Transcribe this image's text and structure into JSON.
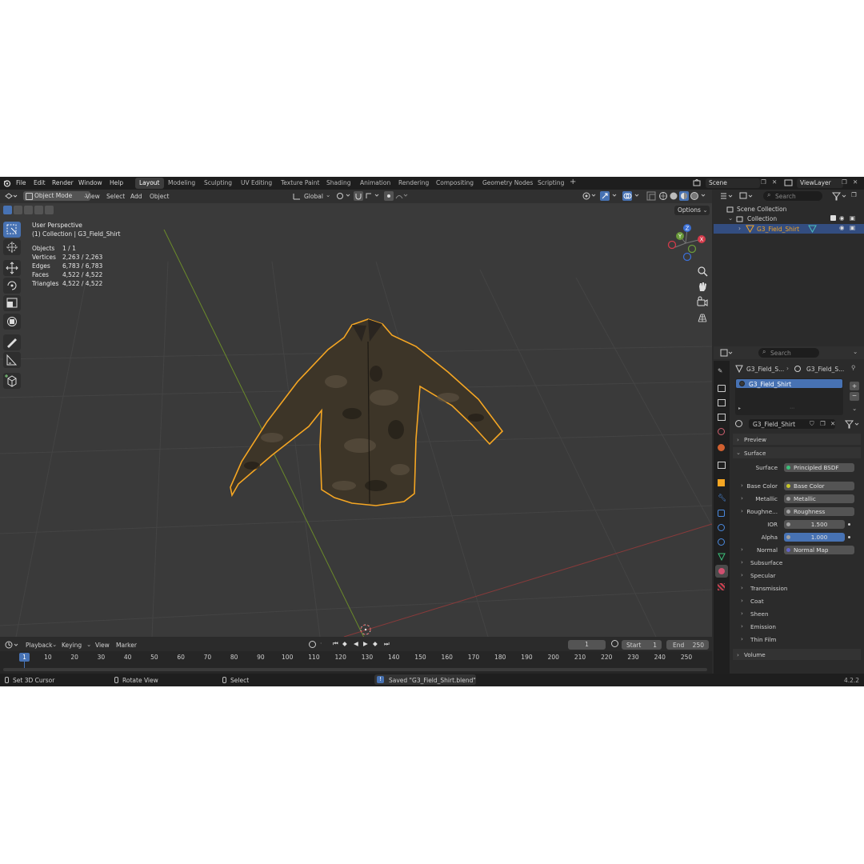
{
  "menu": [
    "File",
    "Edit",
    "Render",
    "Window",
    "Help"
  ],
  "workspaces": [
    "Layout",
    "Modeling",
    "Sculpting",
    "UV Editing",
    "Texture Paint",
    "Shading",
    "Animation",
    "Rendering",
    "Compositing",
    "Geometry Nodes",
    "Scripting"
  ],
  "active_workspace": "Layout",
  "scene": "Scene",
  "view_layer": "ViewLayer",
  "viewport": {
    "mode": "Object Mode",
    "menus": [
      "View",
      "Select",
      "Add",
      "Object"
    ],
    "orientation": "Global",
    "options": "Options",
    "perspective": "User Perspective",
    "collection_line": "(1) Collection | G3_Field_Shirt",
    "stats": [
      {
        "label": "Objects",
        "value": "1 / 1"
      },
      {
        "label": "Vertices",
        "value": "2,263 / 2,263"
      },
      {
        "label": "Edges",
        "value": "6,783 / 6,783"
      },
      {
        "label": "Faces",
        "value": "4,522 / 4,522"
      },
      {
        "label": "Triangles",
        "value": "4,522 / 4,522"
      }
    ],
    "gizmo": {
      "z": "Z",
      "y": "Y",
      "x": "X"
    }
  },
  "outliner": {
    "search_placeholder": "Search",
    "scene_collection": "Scene Collection",
    "collection": "Collection",
    "object": "G3_Field_Shirt"
  },
  "properties": {
    "search_placeholder": "Search",
    "breadcrumb_object": "G3_Field_S...",
    "breadcrumb_material": "G3_Field_S...",
    "slot": "G3_Field_Shirt",
    "material_name": "G3_Field_Shirt",
    "preview": "Preview",
    "surface_section": "Surface",
    "surface_label": "Surface",
    "surface_value": "Principled BSDF",
    "rows": [
      {
        "label": "Base Color",
        "value": "Base Color",
        "dot": "#c7c729"
      },
      {
        "label": "Metallic",
        "value": "Metallic",
        "dot": "#a1a1a1"
      },
      {
        "label": "Roughne...",
        "value": "Roughness",
        "dot": "#a1a1a1"
      }
    ],
    "ior_label": "IOR",
    "ior_value": "1.500",
    "alpha_label": "Alpha",
    "alpha_value": "1.000",
    "normal_label": "Normal",
    "normal_value": "Normal Map",
    "subsections": [
      "Subsurface",
      "Specular",
      "Transmission",
      "Coat",
      "Sheen",
      "Emission",
      "Thin Film"
    ],
    "volume": "Volume"
  },
  "timeline": {
    "menus": [
      "Playback",
      "Keying",
      "View",
      "Marker"
    ],
    "current_frame": "1",
    "start_label": "Start",
    "start": "1",
    "end_label": "End",
    "end": "250",
    "playhead": "1",
    "ticks": [
      "10",
      "20",
      "30",
      "40",
      "50",
      "60",
      "70",
      "80",
      "90",
      "100",
      "110",
      "120",
      "130",
      "140",
      "150",
      "160",
      "170",
      "180",
      "190",
      "200",
      "210",
      "220",
      "230",
      "240",
      "250"
    ]
  },
  "status": {
    "left": "Set 3D Cursor",
    "middle": "Rotate View",
    "right": "Select",
    "message": "Saved \"G3_Field_Shirt.blend\"",
    "version": "4.2.2"
  },
  "colors": {
    "accent": "#4772b3",
    "selection_outline": "#f5a623"
  }
}
